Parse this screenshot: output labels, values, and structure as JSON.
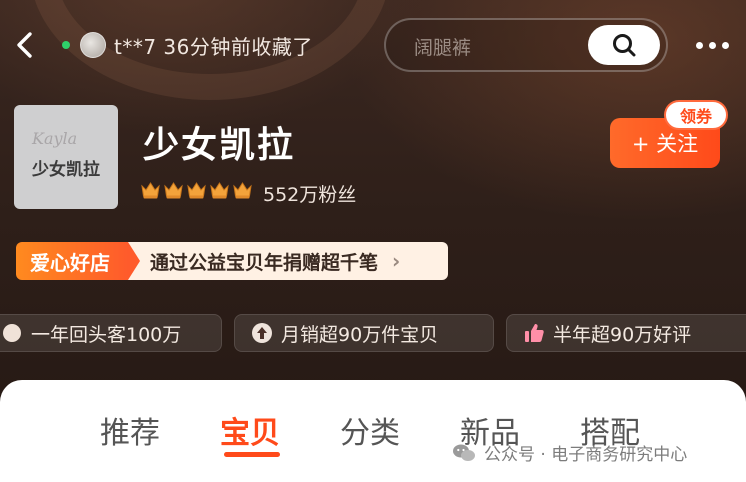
{
  "topbar": {
    "visitor_text": "t**7 36分钟前收藏了",
    "search_placeholder": "阔腿裤"
  },
  "store": {
    "logo_script": "Kayla",
    "logo_name": "少女凯拉",
    "name": "少女凯拉",
    "crown_count": 5,
    "fans": "552万粉丝",
    "follow_label": "+ 关注",
    "coupon_label": "领券"
  },
  "charity": {
    "tag": "爱心好店",
    "text": "通过公益宝贝年捐赠超千笔"
  },
  "chips": [
    {
      "label": "一年回头客100万",
      "icon": "repeat-customer-icon"
    },
    {
      "label": "月销超90万件宝贝",
      "icon": "arrow-up-icon"
    },
    {
      "label": "半年超90万好评",
      "icon": "thumbs-up-icon"
    }
  ],
  "tabs": [
    {
      "label": "推荐",
      "active": false
    },
    {
      "label": "宝贝",
      "active": true
    },
    {
      "label": "分类",
      "active": false
    },
    {
      "label": "新品",
      "active": false
    },
    {
      "label": "搭配",
      "active": false
    }
  ],
  "watermark": {
    "text": "公众号 · 电子商务研究中心",
    "icon": "wechat-icon"
  },
  "colors": {
    "accent": "#ff4a1a",
    "online": "#2fd16a",
    "crown": "#f3a33b"
  }
}
